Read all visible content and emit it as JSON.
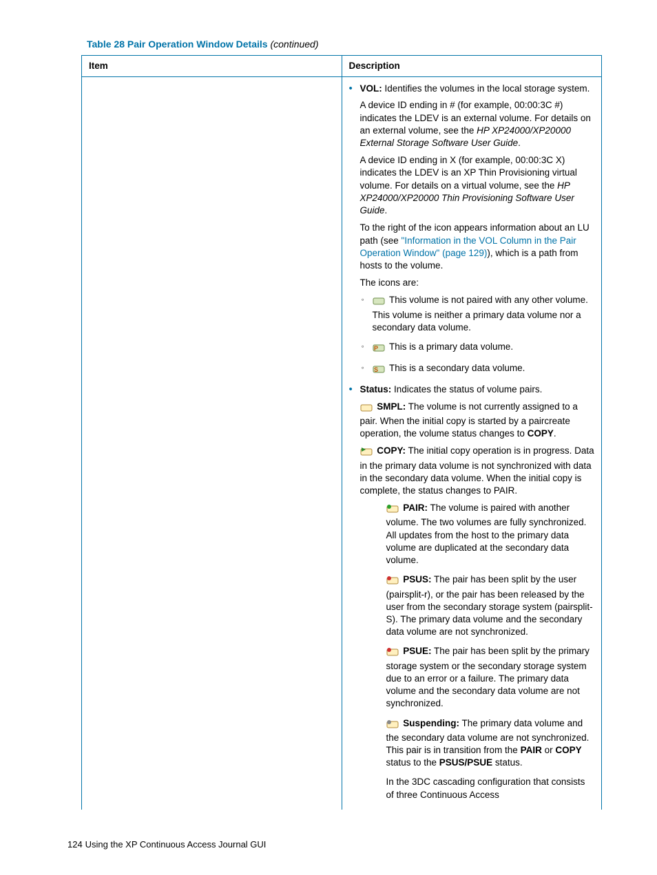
{
  "table_caption": "Table 28 Pair Operation Window Details",
  "table_caption_suffix": "(continued)",
  "headers": {
    "item": "Item",
    "description": "Description"
  },
  "desc": {
    "vol": {
      "label": "VOL:",
      "intro": " Identifies the volumes in the local storage system.",
      "p1a": "A device ID ending in # (for example, 00:00:3C #) indicates the LDEV is an external volume. For details on an external volume, see the ",
      "p1i": "HP XP24000/XP20000 External Storage Software User Guide",
      "p1z": ".",
      "p2a": "A device ID ending in X (for example, 00:00:3C X) indicates the LDEV is an XP Thin Provisioning virtual volume. For details on a virtual volume, see the ",
      "p2i": "HP XP24000/XP20000 Thin Provisioning Software User Guide",
      "p2z": ".",
      "p3a": "To the right of the icon appears information about an LU path (see ",
      "p3link": "\"Information in the VOL Column in the Pair Operation Window\" (page 129)",
      "p3z": "), which is a path from hosts to the volume.",
      "icons_intro": "The icons are:",
      "icon1": " This volume is not paired with any other volume. This volume is neither a primary data volume nor a secondary data volume.",
      "icon2": " This is a primary data volume.",
      "icon3": " This is a secondary data volume."
    },
    "status": {
      "label": "Status:",
      "intro": " Indicates the status of volume pairs.",
      "smpl": {
        "label": " SMPL:",
        "a": " The volume is not currently assigned to a pair. When the initial copy is started by a paircreate operation, the volume status changes to ",
        "b": "COPY",
        "c": "."
      },
      "copy": {
        "label": " COPY:",
        "t": " The initial copy operation is in progress. Data in the primary data volume is not synchronized with data in the secondary data volume. When the initial copy is complete, the status changes to PAIR."
      },
      "pair": {
        "label": " PAIR:",
        "t": " The volume is paired with another volume. The two volumes are fully synchronized. All updates from the host to the primary data volume are duplicated at the secondary data volume."
      },
      "psus": {
        "label": " PSUS:",
        "t": " The pair has been split by the user (pairsplit-r), or the pair has been released by the user from the secondary storage system (pairsplit-S). The primary data volume and the secondary data volume are not synchronized."
      },
      "psue": {
        "label": " PSUE:",
        "t": " The pair has been split by the primary storage system or the secondary storage system due to an error or a failure. The primary data volume and the secondary data volume are not synchronized."
      },
      "susp": {
        "label": " Suspending:",
        "a": " The primary data volume and the secondary data volume are not synchronized. This pair is in transition from the ",
        "b": "PAIR",
        "c": " or ",
        "d": "COPY",
        "e": " status to the ",
        "f": "PSUS/PSUE",
        "g": " status."
      },
      "trail": "In the 3DC cascading configuration that consists of three Continuous Access"
    }
  },
  "footer": {
    "page": "124",
    "chapter": "Using the XP Continuous Access Journal GUI"
  }
}
